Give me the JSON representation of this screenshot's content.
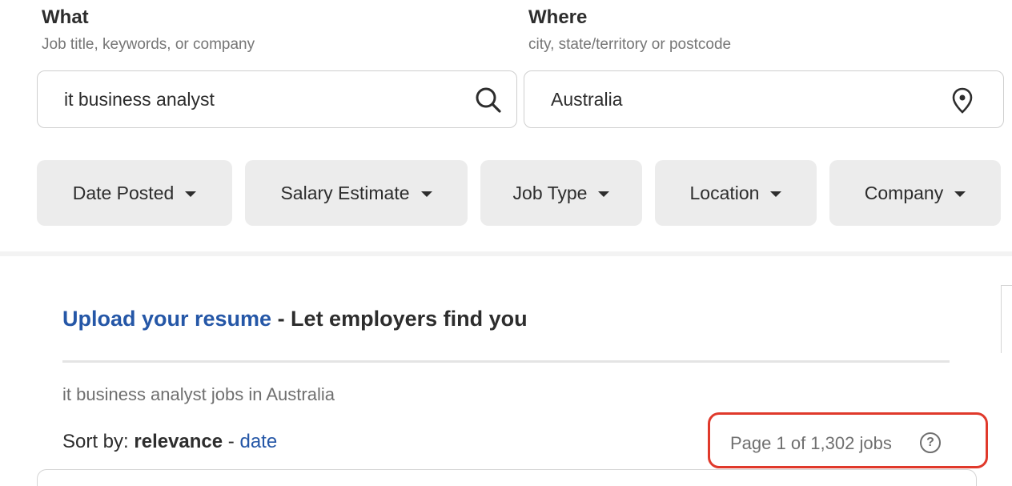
{
  "search": {
    "what": {
      "title": "What",
      "hint": "Job title, keywords, or company",
      "value": "it business analyst"
    },
    "where": {
      "title": "Where",
      "hint": "city, state/territory or postcode",
      "value": "Australia"
    }
  },
  "filters": [
    {
      "label": "Date Posted"
    },
    {
      "label": "Salary Estimate"
    },
    {
      "label": "Job Type"
    },
    {
      "label": "Location"
    },
    {
      "label": "Company"
    }
  ],
  "promo": {
    "link_text": "Upload your resume",
    "rest_text": " - Let employers find you"
  },
  "results": {
    "summary": "it business analyst jobs in Australia",
    "sort_label": "Sort by: ",
    "sort_active": "relevance",
    "sort_separator": " - ",
    "sort_alt": "date",
    "count_text": "Page 1 of 1,302 jobs",
    "help_glyph": "?"
  },
  "colors": {
    "link": "#2557a7",
    "highlight": "#e0392b",
    "filter_bg": "#ececec"
  },
  "icons": {
    "what_input": "search-icon",
    "where_input": "location-pin-icon",
    "count": "help-circle-icon"
  }
}
